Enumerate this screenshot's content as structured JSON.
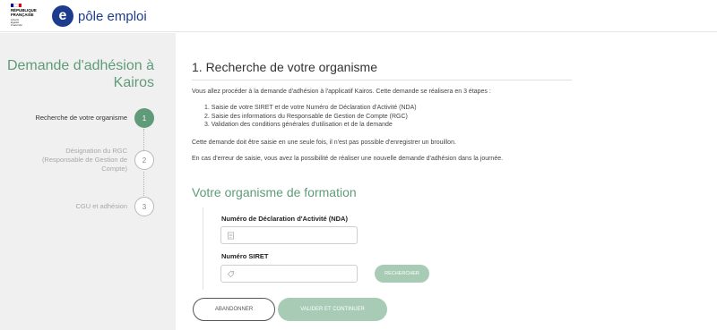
{
  "header": {
    "rf_logo": {
      "line1": "RÉPUBLIQUE",
      "line2": "FRANÇAISE",
      "motto": "Liberté\nÉgalité\nFraternité",
      "flag_colors": [
        "#000091",
        "#ffffff",
        "#e1000f"
      ]
    },
    "pe_logo": {
      "mark": "e",
      "word": "pôle emploi",
      "brand_color": "#1d3c8e"
    }
  },
  "sidebar": {
    "title": "Demande d'adhésion à Kairos",
    "steps": [
      {
        "label": "Recherche de votre organisme",
        "number": "1",
        "state": "active"
      },
      {
        "label": "Désignation du RGC (Responsable de Gestion de Compte)",
        "number": "2",
        "state": "inactive"
      },
      {
        "label": "CGU et adhésion",
        "number": "3",
        "state": "inactive"
      }
    ],
    "accent_color": "#5f9b78"
  },
  "main": {
    "section_title": "1. Recherche de votre organisme",
    "intro": "Vous allez procéder à la demande d'adhésion à l'applicatif Kairos. Cette demande se réalisera en 3 étapes :",
    "steps": [
      "1. Saisie de votre SIRET et de votre Numéro de Déclaration d'Activité (NDA)",
      "2. Saisie des informations du Responsable de Gestion de Compte (RGC)",
      "3. Validation des conditions générales d'utilisation et de la demande"
    ],
    "para1": "Cette demande doit être saisie en une seule fois, il n'est pas possible d'enregistrer un brouillon.",
    "para2": "En cas d'erreur de saisie, vous avez la possibilité de réaliser une nouvelle demande d'adhésion dans la journée.",
    "org_title": "Votre organisme de formation"
  },
  "form": {
    "nda_label": "Numéro de Déclaration d'Activité (NDA)",
    "nda_value": "",
    "siret_label": "Numéro SIRET",
    "siret_value": "",
    "search_button": "RECHERCHER"
  },
  "actions": {
    "cancel": "ABANDONNER",
    "submit": "VALIDER ET CONTINUER"
  }
}
